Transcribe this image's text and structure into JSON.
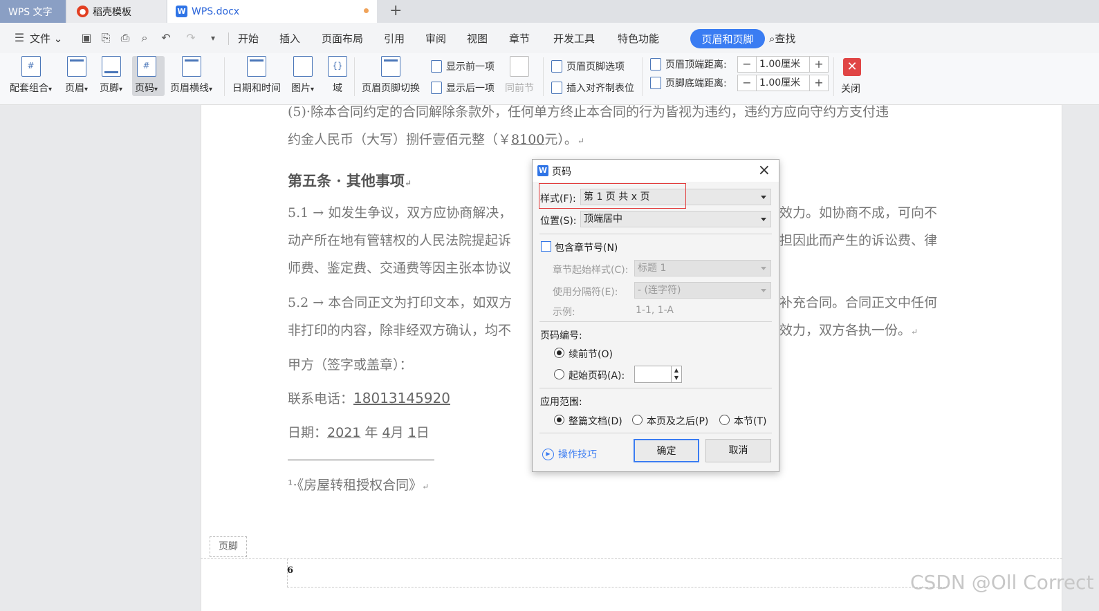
{
  "tabs": [
    {
      "label": "WPS 文字"
    },
    {
      "label": "稻壳模板"
    },
    {
      "label": "WPS.docx"
    }
  ],
  "menubar": {
    "file": "文件",
    "items": [
      "开始",
      "插入",
      "页面布局",
      "引用",
      "审阅",
      "视图",
      "章节",
      "开发工具",
      "特色功能"
    ],
    "active": "页眉和页脚",
    "search": "查找"
  },
  "ribbon": {
    "combo": "配套组合",
    "header": "页眉",
    "footer": "页脚",
    "pagenum": "页码",
    "headerline": "页眉横线",
    "datetime": "日期和时间",
    "picture": "图片",
    "field": "域",
    "switch": "页眉页脚切换",
    "show_prev": "显示前一项",
    "show_next": "显示后一项",
    "same_as_prev": "同前节",
    "hf_options": "页眉页脚选项",
    "insert_tab": "插入对齐制表位",
    "header_top_label": "页眉顶端距离:",
    "header_top_value": "1.00厘米",
    "footer_bottom_label": "页脚底端距离:",
    "footer_bottom_value": "1.00厘米",
    "close": "关闭",
    "minus": "−",
    "plus": "+"
  },
  "document": {
    "line1": "(5)·除本合同约定的合同解除条款外，任何单方终止本合同的行为皆视为违约，违约方应向守约方支付违",
    "line2_pre": "约金人民币（大写）捌仟壹佰元整（￥",
    "line2_amount": "8100",
    "line2_post": "元）。",
    "article5": "第五条 · 其他事项",
    "p51_l1a": "5.1 → 如发生争议，双方应协商解决，",
    "p51_l1b": "效力。如协商不成，可向不",
    "p51_l2a": "动产所在地有管辖权的人民法院提起诉",
    "p51_l2b": "担因此而产生的诉讼费、律",
    "p51_l3a": "师费、鉴定费、交通费等因主张本协议",
    "p52_l1a": "5.2 → 本合同正文为打印文本，如双方",
    "p52_l1b": "补充合同。合同正文中任何",
    "p52_l2a": "非打印的内容，除非经双方确认，均不",
    "p52_l2b": "效力，双方各执一份。",
    "party_a": "甲方（签字或盖章）：",
    "phone_label": "联系电话：",
    "phone": "18013145920",
    "date_label": "日期：",
    "date_year": "2021",
    "date_year_unit": "年",
    "date_month": "4",
    "date_month_unit": "月",
    "date_day": "1",
    "date_day_unit": "日",
    "footnote": "¹·《房屋转租授权合同》",
    "footer_tag": "页脚",
    "footer_number": "6",
    "watermark": "CSDN @Oll Correct"
  },
  "dialog": {
    "title": "页码",
    "style_label": "样式(F):",
    "style_value": "第 1 页 共 x 页",
    "position_label": "位置(S):",
    "position_value": "顶端居中",
    "include_chapter": "包含章节号(N)",
    "chapter_style_label": "章节起始样式(C):",
    "chapter_style_value": "标题 1",
    "separator_label": "使用分隔符(E):",
    "separator_value": "-   (连字符)",
    "example_label": "示例:",
    "example_value": "1-1, 1-A",
    "numbering_label": "页码编号:",
    "continue_prev": "续前节(O)",
    "start_at": "起始页码(A):",
    "start_value": "",
    "apply_label": "应用范围:",
    "apply_whole": "整篇文档(D)",
    "apply_after": "本页及之后(P)",
    "apply_section": "本节(T)",
    "tips": "操作技巧",
    "ok": "确定",
    "cancel": "取消"
  }
}
